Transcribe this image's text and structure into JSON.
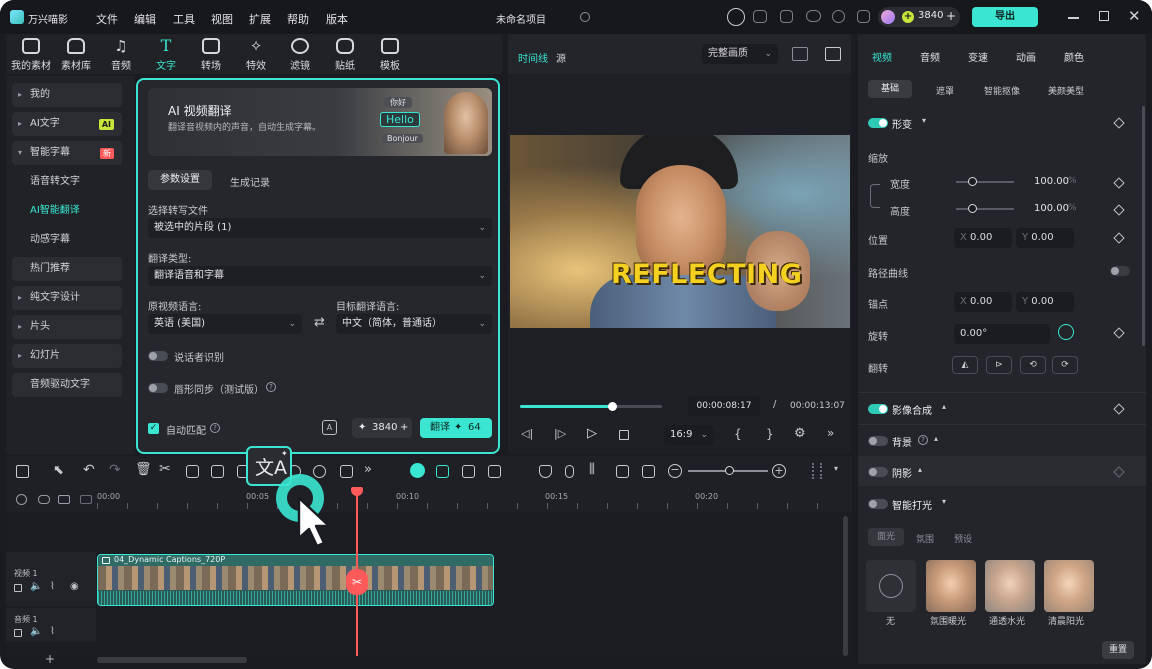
{
  "app": {
    "name": "万兴喵影",
    "project_title": "未命名项目",
    "menu": [
      "文件",
      "编辑",
      "工具",
      "视图",
      "扩展",
      "帮助",
      "版本"
    ],
    "credits": "3840",
    "export_label": "导出"
  },
  "toolbar": {
    "items": [
      {
        "label": "我的素材",
        "icon": "my-media-icon"
      },
      {
        "label": "素材库",
        "icon": "library-icon"
      },
      {
        "label": "音频",
        "icon": "music-note-icon"
      },
      {
        "label": "文字",
        "icon": "text-t-icon"
      },
      {
        "label": "转场",
        "icon": "transition-icon"
      },
      {
        "label": "特效",
        "icon": "effects-icon"
      },
      {
        "label": "滤镜",
        "icon": "filter-icon"
      },
      {
        "label": "贴纸",
        "icon": "sticker-icon"
      },
      {
        "label": "模板",
        "icon": "template-icon"
      }
    ],
    "active": "文字"
  },
  "sidebar": {
    "items": [
      {
        "label": "我的",
        "caret": true
      },
      {
        "label": "AI文字",
        "caret": true,
        "badge": "AI"
      },
      {
        "label": "智能字幕",
        "caret": true,
        "badge": "新"
      },
      {
        "label": "语音转文字",
        "sub": true
      },
      {
        "label": "AI智能翻译",
        "sub": true,
        "active": true
      },
      {
        "label": "动感字幕",
        "sub": true
      },
      {
        "label": "热门推荐"
      },
      {
        "label": "纯文字设计",
        "caret": true
      },
      {
        "label": "片头",
        "caret": true
      },
      {
        "label": "幻灯片",
        "caret": true
      },
      {
        "label": "音频驱动文字"
      }
    ]
  },
  "dialog": {
    "banner_title": "AI 视频翻译",
    "banner_subtitle": "翻译音视频内的声音，自动生成字幕。",
    "banner_words": [
      "你好",
      "Hello",
      "Bonjour"
    ],
    "tabs": [
      "参数设置",
      "生成记录"
    ],
    "file_label": "选择转写文件",
    "file_value": "被选中的片段 (1)",
    "type_label": "翻译类型:",
    "type_value": "翻译语音和字幕",
    "source_lang_label": "原视频语言:",
    "source_lang_value": "英语 (美国)",
    "target_lang_label": "目标翻译语言:",
    "target_lang_value": "中文（简体，普通话）",
    "speaker_label": "说话者识别",
    "lipsync_label": "唇形同步（测试版）",
    "auto_match_label": "自动匹配",
    "credits": "3840",
    "translate_label": "翻译",
    "translate_cost": "64"
  },
  "preview": {
    "tab_timeline": "时间线",
    "tab_source": "源",
    "quality": "完整画质",
    "caption": "REFLECTING",
    "current_time": "00:00:08:17",
    "separator": "/",
    "total_time": "00:00:13:07",
    "aspect": "16:9",
    "progress": 0.65
  },
  "inspector": {
    "tabs": [
      "视频",
      "音频",
      "变速",
      "动画",
      "颜色"
    ],
    "subtabs": [
      "基础",
      "遮罩",
      "智能抠像",
      "美颜美型"
    ],
    "transform_label": "形变",
    "scale_label": "缩放",
    "width_label": "宽度",
    "width_value": "100.00",
    "height_label": "高度",
    "height_value": "100.00",
    "percent": "%",
    "position_label": "位置",
    "x_label": "X",
    "y_label": "Y",
    "pos_x": "0.00",
    "pos_y": "0.00",
    "path_label": "路径曲线",
    "anchor_label": "锚点",
    "anchor_x": "0.00",
    "anchor_y": "0.00",
    "rotate_label": "旋转",
    "rotate_value": "0.00°",
    "flip_label": "翻转",
    "compositing_label": "影像合成",
    "background_label": "背景",
    "shadow_label": "阴影",
    "lighting_label": "智能打光",
    "lighting_tabs": [
      "面光",
      "氛围",
      "预设"
    ],
    "presets": [
      "无",
      "氛围暖光",
      "通透水光",
      "清晨阳光"
    ],
    "reset_label": "重置"
  },
  "timeline": {
    "ruler": [
      "00:00",
      "00:05",
      "00:10",
      "00:15",
      "00:20"
    ],
    "clip_name": "04_Dynamic Captions_720P",
    "video_track": "视频 1",
    "audio_track": "音频 1"
  },
  "colors": {
    "accent": "#3ae6d2",
    "playhead": "#ff5a5a",
    "panel": "#23252b"
  }
}
